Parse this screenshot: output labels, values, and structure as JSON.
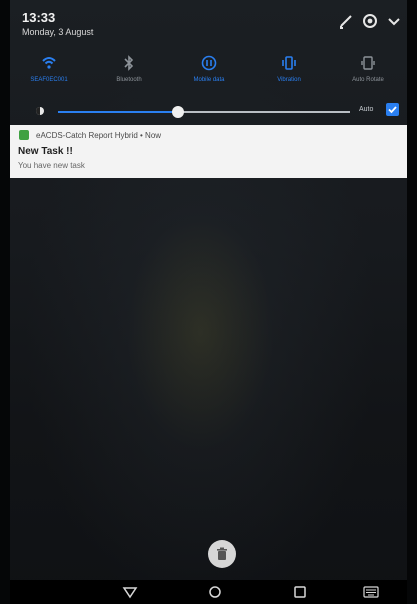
{
  "status": {
    "time": "13:33",
    "date": "Monday, 3 August"
  },
  "quick_settings": [
    {
      "label": "SEAF0EC001",
      "icon": "wifi-icon",
      "active": true
    },
    {
      "label": "Bluetooth",
      "icon": "bluetooth-icon",
      "active": false
    },
    {
      "label": "Mobile data",
      "icon": "mobile-data-icon",
      "active": true
    },
    {
      "label": "Vibration",
      "icon": "vibration-icon",
      "active": true
    },
    {
      "label": "Auto Rotate",
      "icon": "auto-rotate-icon",
      "active": false
    }
  ],
  "brightness": {
    "level": 0.41,
    "auto_label": "Auto",
    "auto_checked": true
  },
  "notification": {
    "app_line": "eACDS-Catch Report Hybrid • Now",
    "title": "New Task !!",
    "text": "You have new task"
  },
  "colors": {
    "accent": "#2a7ff0",
    "app_icon": "#3fa142"
  }
}
